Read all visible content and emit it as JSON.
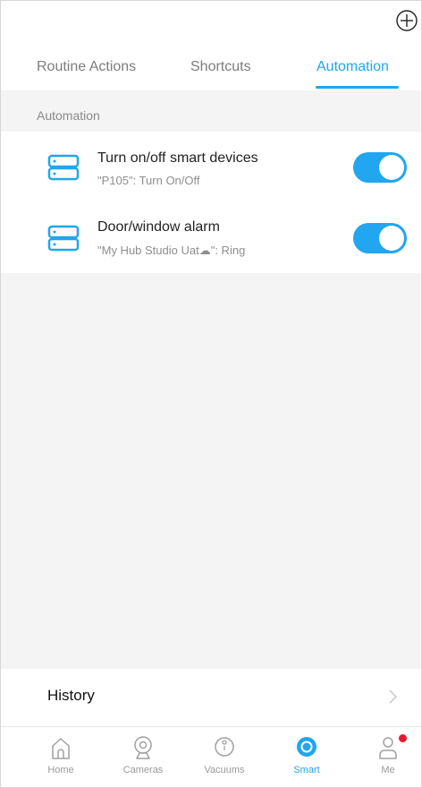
{
  "header": {
    "add_icon": "plus-circle-icon"
  },
  "tabs": [
    {
      "label": "Routine Actions",
      "active": false
    },
    {
      "label": "Shortcuts",
      "active": false
    },
    {
      "label": "Automation",
      "active": true
    }
  ],
  "section": {
    "label": "Automation"
  },
  "automations": [
    {
      "title": "Turn on/off smart devices",
      "subtitle": "\"P105\": Turn On/Off",
      "enabled": true,
      "icon": "hub-device-icon"
    },
    {
      "title": "Door/window alarm",
      "subtitle": "\"My Hub Studio Uat☁\": Ring",
      "enabled": true,
      "icon": "hub-device-icon"
    }
  ],
  "history": {
    "label": "History"
  },
  "bottom_nav": [
    {
      "label": "Home",
      "icon": "home-icon",
      "active": false
    },
    {
      "label": "Cameras",
      "icon": "camera-icon",
      "active": false
    },
    {
      "label": "Vacuums",
      "icon": "vacuum-icon",
      "active": false
    },
    {
      "label": "Smart",
      "icon": "smart-icon",
      "active": true
    },
    {
      "label": "Me",
      "icon": "person-icon",
      "active": false,
      "badge": true
    }
  ],
  "colors": {
    "accent": "#21a6ef",
    "badge": "#e8192c",
    "background": "#f4f4f4"
  }
}
